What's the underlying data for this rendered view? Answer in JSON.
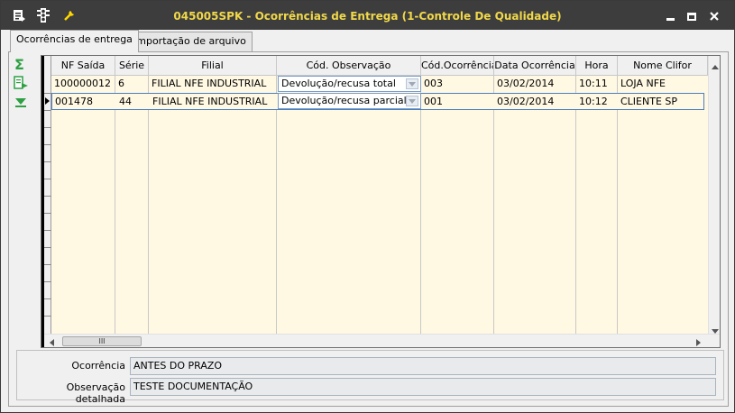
{
  "window": {
    "title": "045005SPK - Ocorrências de Entrega (1-Controle De Qualidade)"
  },
  "tabs": [
    {
      "label": "Ocorrências de entrega",
      "active": true
    },
    {
      "label": "Importação de arquivo",
      "active": false
    }
  ],
  "toolbar": {
    "icons": [
      "sum-icon",
      "export-icon",
      "filter-down-icon"
    ]
  },
  "grid": {
    "columns": [
      "NF Saída",
      "Série",
      "Filial",
      "Cód. Observação",
      "Cód.Ocorrência",
      "Data Ocorrência",
      "Hora",
      "Nome Clifor"
    ],
    "rows": [
      {
        "nf": "100000012",
        "serie": "6",
        "filial": "FILIAL NFE INDUSTRIAL",
        "cod_obs": "Devolução/recusa total",
        "cod_oc": "003",
        "data": "03/02/2014",
        "hora": "10:11",
        "clifor": "LOJA NFE"
      },
      {
        "nf": "001478",
        "serie": "44",
        "filial": "FILIAL NFE INDUSTRIAL",
        "cod_obs": "Devolução/recusa parcial",
        "cod_oc": "001",
        "data": "03/02/2014",
        "hora": "10:12",
        "clifor": "CLIENTE SP"
      }
    ],
    "scroll_thumb_label": "III"
  },
  "details": {
    "ocorrencia_label": "Ocorrência",
    "ocorrencia_value": "ANTES DO PRAZO",
    "obs_label": "Observação detalhada",
    "obs_value": "TESTE DOCUMENTAÇÃO"
  },
  "colors": {
    "title_text": "#f0d84a",
    "title_bg": "#3d3d3d",
    "grid_bg": "#fff8e3",
    "accent_green": "#2ea043"
  }
}
